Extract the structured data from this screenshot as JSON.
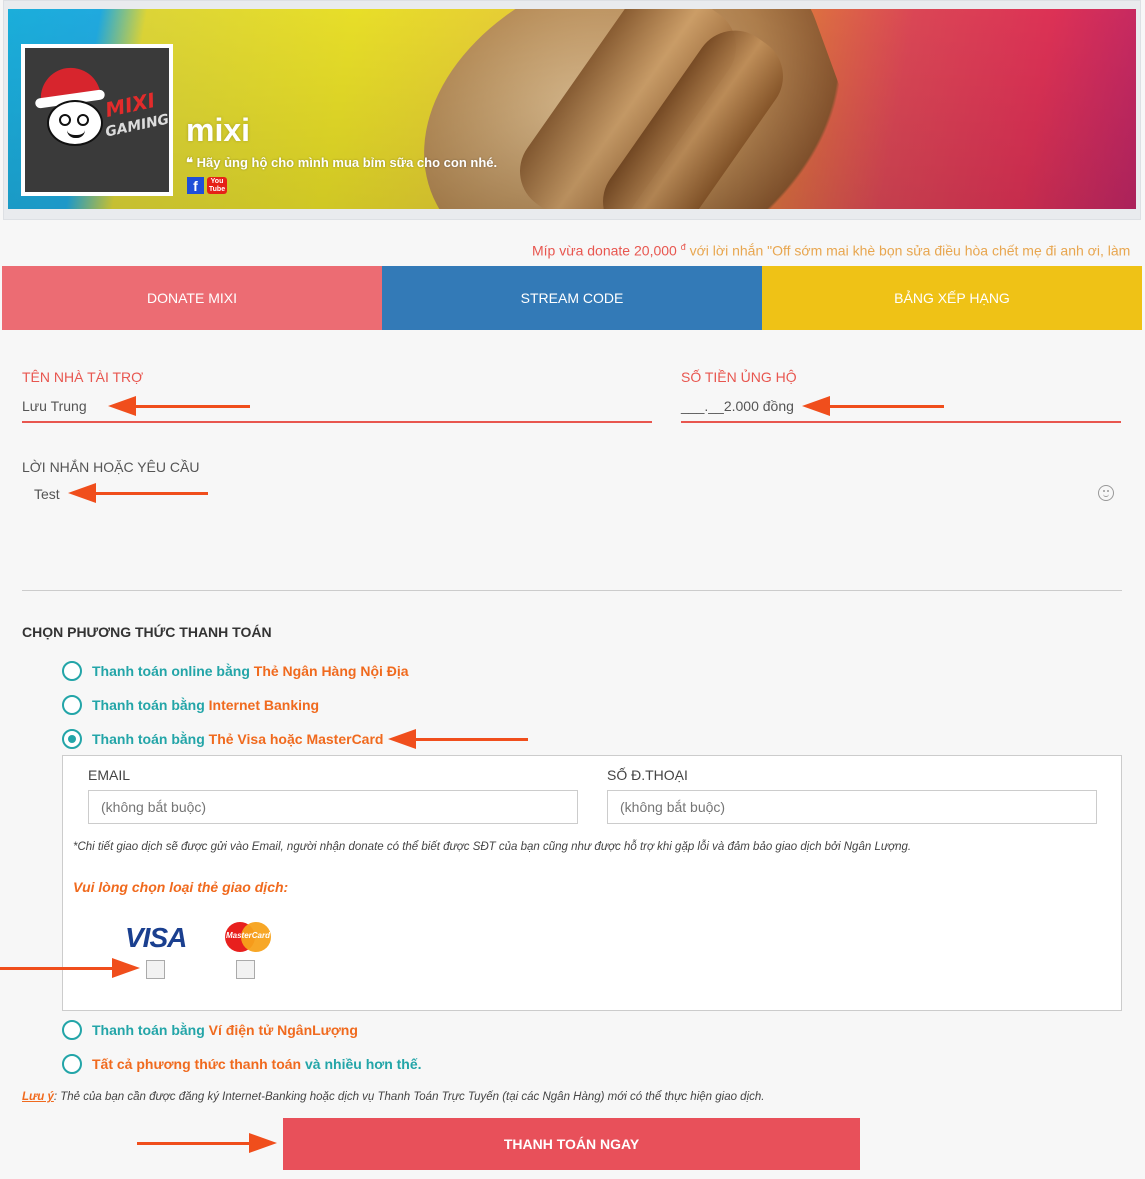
{
  "header": {
    "name": "mixi",
    "quote": "❝ Hãy ủng hộ cho mình mua bỉm sữa cho con nhé.",
    "avatar_text_1": "MIXI",
    "avatar_text_2": "GAMING",
    "facebook_label": "f",
    "youtube_label": "You Tube"
  },
  "ticker": {
    "name": "Míp vừa donate",
    "amount": "20,000",
    "currency": "đ",
    "message": "với lời nhắn \"Off sớm mai khè bọn sửa điều hòa chết mẹ đi anh ơi, làm"
  },
  "tabs": [
    {
      "label": "DONATE MIXI",
      "color": "#ec6c73"
    },
    {
      "label": "STREAM CODE",
      "color": "#337ab7"
    },
    {
      "label": "BẢNG XẾP HẠNG",
      "color": "#efc216"
    }
  ],
  "form": {
    "sponsor_label": "TÊN NHÀ TÀI TRỢ",
    "sponsor_value": "Lưu Trung",
    "amount_label": "SỐ TIỀN ỦNG HỘ",
    "amount_value": "___.__2.000 đồng",
    "message_label": "LỜI NHẮN HOẶC YÊU CẦU",
    "message_value": "Test"
  },
  "payment": {
    "title": "CHỌN PHƯƠNG THỨC THANH TOÁN",
    "options": [
      {
        "prefix": "Thanh toán online bằng",
        "highlight": "Thẻ Ngân Hàng Nội Địa",
        "suffix": "",
        "checked": false
      },
      {
        "prefix": "Thanh toán bằng",
        "highlight": "Internet Banking",
        "suffix": "",
        "checked": false
      },
      {
        "prefix": "Thanh toán bằng",
        "highlight": "Thẻ Visa hoặc MasterCard",
        "suffix": "",
        "checked": true
      },
      {
        "prefix": "Thanh toán bằng",
        "highlight": "Ví điện tử NgânLượng",
        "suffix": "",
        "checked": false
      },
      {
        "prefix": "",
        "highlight": "Tất cả phương thức thanh toán",
        "suffix": "và nhiều hơn thế.",
        "checked": false
      }
    ],
    "visa_box": {
      "email_label": "EMAIL",
      "email_placeholder": "(không bắt buộc)",
      "phone_label": "SỐ Đ.THOẠI",
      "phone_placeholder": "(không bắt buộc)",
      "note": "*Chi tiết giao dịch sẽ được gửi vào Email, người nhận donate có thể biết được SĐT của bạn cũng như được hỗ trợ khi gặp lỗi và đảm bảo giao dịch bởi Ngân Lượng.",
      "choose_label": "Vui lòng chọn loại thẻ giao dịch:",
      "visa_label": "VISA",
      "mastercard_label": "MasterCard"
    },
    "note_key": "Lưu ý",
    "note_text": ": Thẻ của bạn cần được đăng ký Internet-Banking hoặc dịch vụ Thanh Toán Trực Tuyến (tại các Ngân Hàng) mới có thể thực hiện giao dịch.",
    "submit_label": "THANH TOÁN NGAY"
  },
  "colors": {
    "accent_red": "#e8564f",
    "teal": "#23a5a8",
    "orange": "#f06a1e",
    "button": "#e8505a",
    "annotation_arrow": "#f04e1c"
  }
}
